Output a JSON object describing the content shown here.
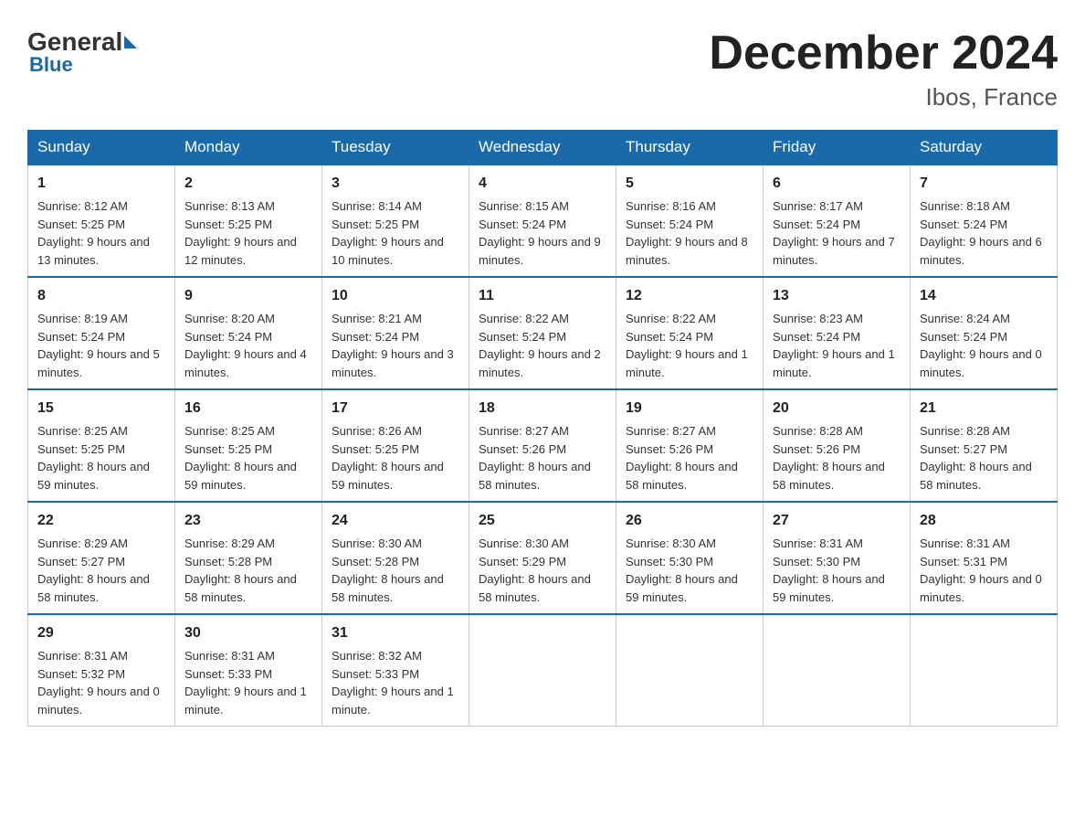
{
  "header": {
    "logo_general": "General",
    "logo_blue": "Blue",
    "title": "December 2024",
    "location": "Ibos, France"
  },
  "days_of_week": [
    "Sunday",
    "Monday",
    "Tuesday",
    "Wednesday",
    "Thursday",
    "Friday",
    "Saturday"
  ],
  "weeks": [
    [
      {
        "day": "1",
        "sunrise": "8:12 AM",
        "sunset": "5:25 PM",
        "daylight": "9 hours and 13 minutes."
      },
      {
        "day": "2",
        "sunrise": "8:13 AM",
        "sunset": "5:25 PM",
        "daylight": "9 hours and 12 minutes."
      },
      {
        "day": "3",
        "sunrise": "8:14 AM",
        "sunset": "5:25 PM",
        "daylight": "9 hours and 10 minutes."
      },
      {
        "day": "4",
        "sunrise": "8:15 AM",
        "sunset": "5:24 PM",
        "daylight": "9 hours and 9 minutes."
      },
      {
        "day": "5",
        "sunrise": "8:16 AM",
        "sunset": "5:24 PM",
        "daylight": "9 hours and 8 minutes."
      },
      {
        "day": "6",
        "sunrise": "8:17 AM",
        "sunset": "5:24 PM",
        "daylight": "9 hours and 7 minutes."
      },
      {
        "day": "7",
        "sunrise": "8:18 AM",
        "sunset": "5:24 PM",
        "daylight": "9 hours and 6 minutes."
      }
    ],
    [
      {
        "day": "8",
        "sunrise": "8:19 AM",
        "sunset": "5:24 PM",
        "daylight": "9 hours and 5 minutes."
      },
      {
        "day": "9",
        "sunrise": "8:20 AM",
        "sunset": "5:24 PM",
        "daylight": "9 hours and 4 minutes."
      },
      {
        "day": "10",
        "sunrise": "8:21 AM",
        "sunset": "5:24 PM",
        "daylight": "9 hours and 3 minutes."
      },
      {
        "day": "11",
        "sunrise": "8:22 AM",
        "sunset": "5:24 PM",
        "daylight": "9 hours and 2 minutes."
      },
      {
        "day": "12",
        "sunrise": "8:22 AM",
        "sunset": "5:24 PM",
        "daylight": "9 hours and 1 minute."
      },
      {
        "day": "13",
        "sunrise": "8:23 AM",
        "sunset": "5:24 PM",
        "daylight": "9 hours and 1 minute."
      },
      {
        "day": "14",
        "sunrise": "8:24 AM",
        "sunset": "5:24 PM",
        "daylight": "9 hours and 0 minutes."
      }
    ],
    [
      {
        "day": "15",
        "sunrise": "8:25 AM",
        "sunset": "5:25 PM",
        "daylight": "8 hours and 59 minutes."
      },
      {
        "day": "16",
        "sunrise": "8:25 AM",
        "sunset": "5:25 PM",
        "daylight": "8 hours and 59 minutes."
      },
      {
        "day": "17",
        "sunrise": "8:26 AM",
        "sunset": "5:25 PM",
        "daylight": "8 hours and 59 minutes."
      },
      {
        "day": "18",
        "sunrise": "8:27 AM",
        "sunset": "5:26 PM",
        "daylight": "8 hours and 58 minutes."
      },
      {
        "day": "19",
        "sunrise": "8:27 AM",
        "sunset": "5:26 PM",
        "daylight": "8 hours and 58 minutes."
      },
      {
        "day": "20",
        "sunrise": "8:28 AM",
        "sunset": "5:26 PM",
        "daylight": "8 hours and 58 minutes."
      },
      {
        "day": "21",
        "sunrise": "8:28 AM",
        "sunset": "5:27 PM",
        "daylight": "8 hours and 58 minutes."
      }
    ],
    [
      {
        "day": "22",
        "sunrise": "8:29 AM",
        "sunset": "5:27 PM",
        "daylight": "8 hours and 58 minutes."
      },
      {
        "day": "23",
        "sunrise": "8:29 AM",
        "sunset": "5:28 PM",
        "daylight": "8 hours and 58 minutes."
      },
      {
        "day": "24",
        "sunrise": "8:30 AM",
        "sunset": "5:28 PM",
        "daylight": "8 hours and 58 minutes."
      },
      {
        "day": "25",
        "sunrise": "8:30 AM",
        "sunset": "5:29 PM",
        "daylight": "8 hours and 58 minutes."
      },
      {
        "day": "26",
        "sunrise": "8:30 AM",
        "sunset": "5:30 PM",
        "daylight": "8 hours and 59 minutes."
      },
      {
        "day": "27",
        "sunrise": "8:31 AM",
        "sunset": "5:30 PM",
        "daylight": "8 hours and 59 minutes."
      },
      {
        "day": "28",
        "sunrise": "8:31 AM",
        "sunset": "5:31 PM",
        "daylight": "9 hours and 0 minutes."
      }
    ],
    [
      {
        "day": "29",
        "sunrise": "8:31 AM",
        "sunset": "5:32 PM",
        "daylight": "9 hours and 0 minutes."
      },
      {
        "day": "30",
        "sunrise": "8:31 AM",
        "sunset": "5:33 PM",
        "daylight": "9 hours and 1 minute."
      },
      {
        "day": "31",
        "sunrise": "8:32 AM",
        "sunset": "5:33 PM",
        "daylight": "9 hours and 1 minute."
      },
      null,
      null,
      null,
      null
    ]
  ],
  "labels": {
    "sunrise": "Sunrise:",
    "sunset": "Sunset:",
    "daylight": "Daylight:"
  }
}
